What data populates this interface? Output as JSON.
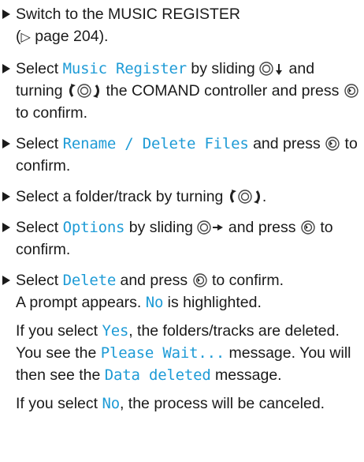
{
  "steps": [
    {
      "text_a": "Switch to the MUSIC REGISTER",
      "text_b": "(",
      "page_ref_arrow": "▷",
      "text_c": " page 204)."
    },
    {
      "t1": "Select ",
      "kw1": "Music Register",
      "t2": " by sliding ",
      "t3": " and turning ",
      "t4": " the COMAND controller and press ",
      "t5": " to confirm."
    },
    {
      "t1": "Select ",
      "kw1": "Rename / Delete Files",
      "t2": " and press ",
      "t3": " to confirm."
    },
    {
      "t1": "Select a folder/track by turning ",
      "t2": "."
    },
    {
      "t1": "Select ",
      "kw1": "Options",
      "t2": " by sliding ",
      "t3": " and press ",
      "t4": " to confirm."
    },
    {
      "t1": "Select ",
      "kw1": "Delete",
      "t2": " and press ",
      "t3": " to confirm.",
      "p1": {
        "t1": "A prompt appears. ",
        "kw1": "No",
        "t2": " is highlighted."
      },
      "p2": {
        "t1": "If you select ",
        "kw1": "Yes",
        "t2": ", the folders/tracks are deleted. You see the ",
        "kw2": "Please Wait...",
        "t3": " message. You will then see the ",
        "kw3": "Data deleted",
        "t4": " message."
      },
      "p3": {
        "t1": "If you select ",
        "kw1": "No",
        "t2": ", the process will be canceled."
      }
    }
  ],
  "colors": {
    "keyword": "#1e9bd6",
    "text": "#1a1a1a"
  }
}
